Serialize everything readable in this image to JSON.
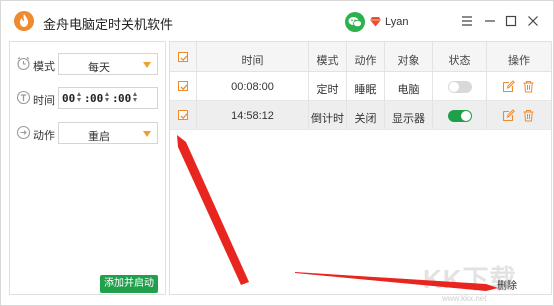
{
  "app": {
    "title": "金舟电脑定时关机软件",
    "user_name": "Lyan",
    "logo_icon": "app-logo-icon",
    "accent_color": "#f08a2e",
    "brand_green": "#21a04c"
  },
  "form": {
    "mode_label": "模式",
    "mode_value": "每天",
    "time_label": "时间",
    "time_hours": "00",
    "time_minutes": "00",
    "time_seconds": "00",
    "action_label": "动作",
    "action_value": "重启",
    "add_button": "添加并启动"
  },
  "table": {
    "headers": [
      "时间",
      "模式",
      "动作",
      "对象",
      "状态",
      "操作"
    ],
    "rows": [
      {
        "checked": true,
        "time": "00:08:00",
        "mode": "定时",
        "action": "睡眠",
        "target": "电脑",
        "enabled": false
      },
      {
        "checked": true,
        "time": "14:58:12",
        "mode": "倒计时",
        "action": "关闭",
        "target": "显示器",
        "enabled": true
      }
    ]
  },
  "footer": {
    "delete_label": "删除"
  },
  "watermark": {
    "text": "KK下载",
    "url": "www.kkx.net"
  }
}
